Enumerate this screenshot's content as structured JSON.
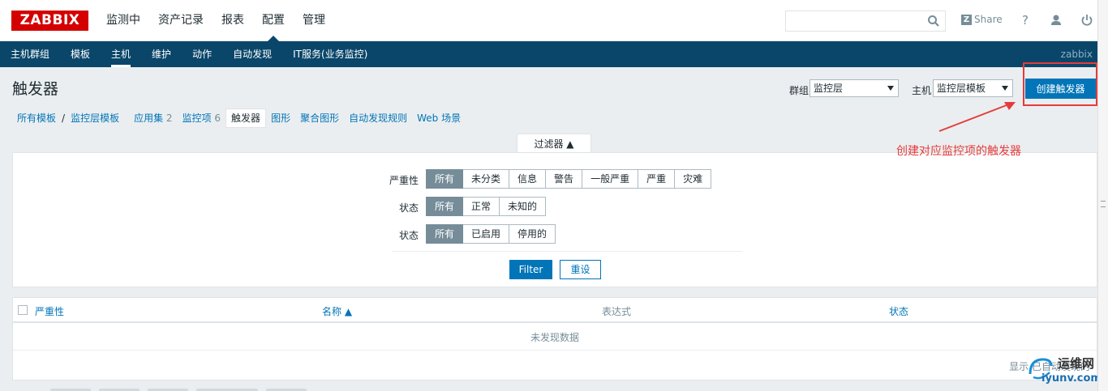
{
  "header": {
    "logo": "ZABBIX",
    "menu": [
      "监测中",
      "资产记录",
      "报表",
      "配置",
      "管理"
    ],
    "share_label": "Share",
    "help_icon": "?",
    "icons": [
      "search-icon",
      "user-icon",
      "power-icon"
    ]
  },
  "subnav": {
    "items": [
      "主机群组",
      "模板",
      "主机",
      "维护",
      "动作",
      "自动发现",
      "IT服务(业务监控)"
    ],
    "user": "zabbix"
  },
  "page": {
    "title": "触发器",
    "group_label": "群组",
    "group_value": "监控层",
    "host_label": "主机",
    "host_value": "监控层模板",
    "create_button": "创建触发器"
  },
  "crumbs": {
    "all_templates": "所有模板",
    "separator": "/",
    "template": "监控层模板",
    "applications": "应用集",
    "applications_count": "2",
    "items": "监控项",
    "items_count": "6",
    "triggers": "触发器",
    "graphs": "图形",
    "screens": "聚合图形",
    "discovery": "自动发现规则",
    "web": "Web 场景"
  },
  "filter": {
    "tab_label": "过滤器 ▲",
    "severity_label": "严重性",
    "severity_options": [
      "所有",
      "未分类",
      "信息",
      "警告",
      "一般严重",
      "严重",
      "灾难"
    ],
    "state_label": "状态",
    "state_options": [
      "所有",
      "正常",
      "未知的"
    ],
    "status_label": "状态",
    "status_options": [
      "所有",
      "已启用",
      "停用的"
    ],
    "filter_button": "Filter",
    "reset_button": "重设"
  },
  "table": {
    "columns": [
      "严重性",
      "名称 ▲",
      "表达式",
      "状态"
    ],
    "empty_text": "未发现数据",
    "footer": "显示 已自动发现的"
  },
  "annotation": {
    "text": "创建对应监控项的触发器"
  },
  "watermark": {
    "title": "运维网",
    "url": "iyunv.com"
  },
  "colors": {
    "brand": "#d40000",
    "nav": "#0a466a",
    "accent": "#0275b8",
    "annotation": "#e53b3b"
  }
}
